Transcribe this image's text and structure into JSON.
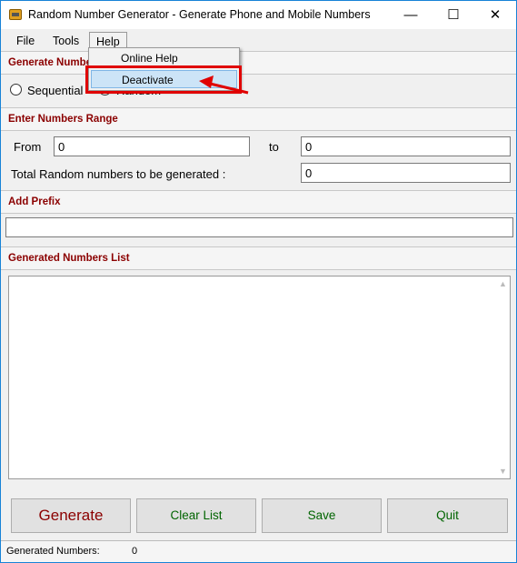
{
  "window": {
    "title": "Random Number Generator - Generate Phone and Mobile Numbers",
    "minimize": "—",
    "maximize": "☐",
    "close": "✕"
  },
  "menu": {
    "items": [
      {
        "label": "File"
      },
      {
        "label": "Tools"
      },
      {
        "label": "Help"
      }
    ],
    "help_dropdown": [
      {
        "label": "Online Help"
      },
      {
        "label": "Deactivate"
      }
    ]
  },
  "generate_section": {
    "title": "Generate Numbers",
    "options": [
      {
        "label": "Sequential",
        "checked": false
      },
      {
        "label": "Random",
        "checked": true
      }
    ]
  },
  "range_section": {
    "title": "Enter Numbers Range",
    "from_label": "From",
    "from_value": "0",
    "to_label": "to",
    "to_value": "0",
    "total_label": "Total Random numbers to be generated :",
    "total_value": "0"
  },
  "prefix_section": {
    "title": "Add Prefix",
    "value": ""
  },
  "list_section": {
    "title": "Generated Numbers List"
  },
  "buttons": {
    "generate": "Generate",
    "clear": "Clear List",
    "save": "Save",
    "quit": "Quit"
  },
  "status": {
    "label": "Generated Numbers:",
    "value": "0"
  },
  "colors": {
    "section_title": "#8b0000",
    "button_text": "#006400",
    "highlight": "#e00000",
    "window_border": "#1883d7"
  }
}
